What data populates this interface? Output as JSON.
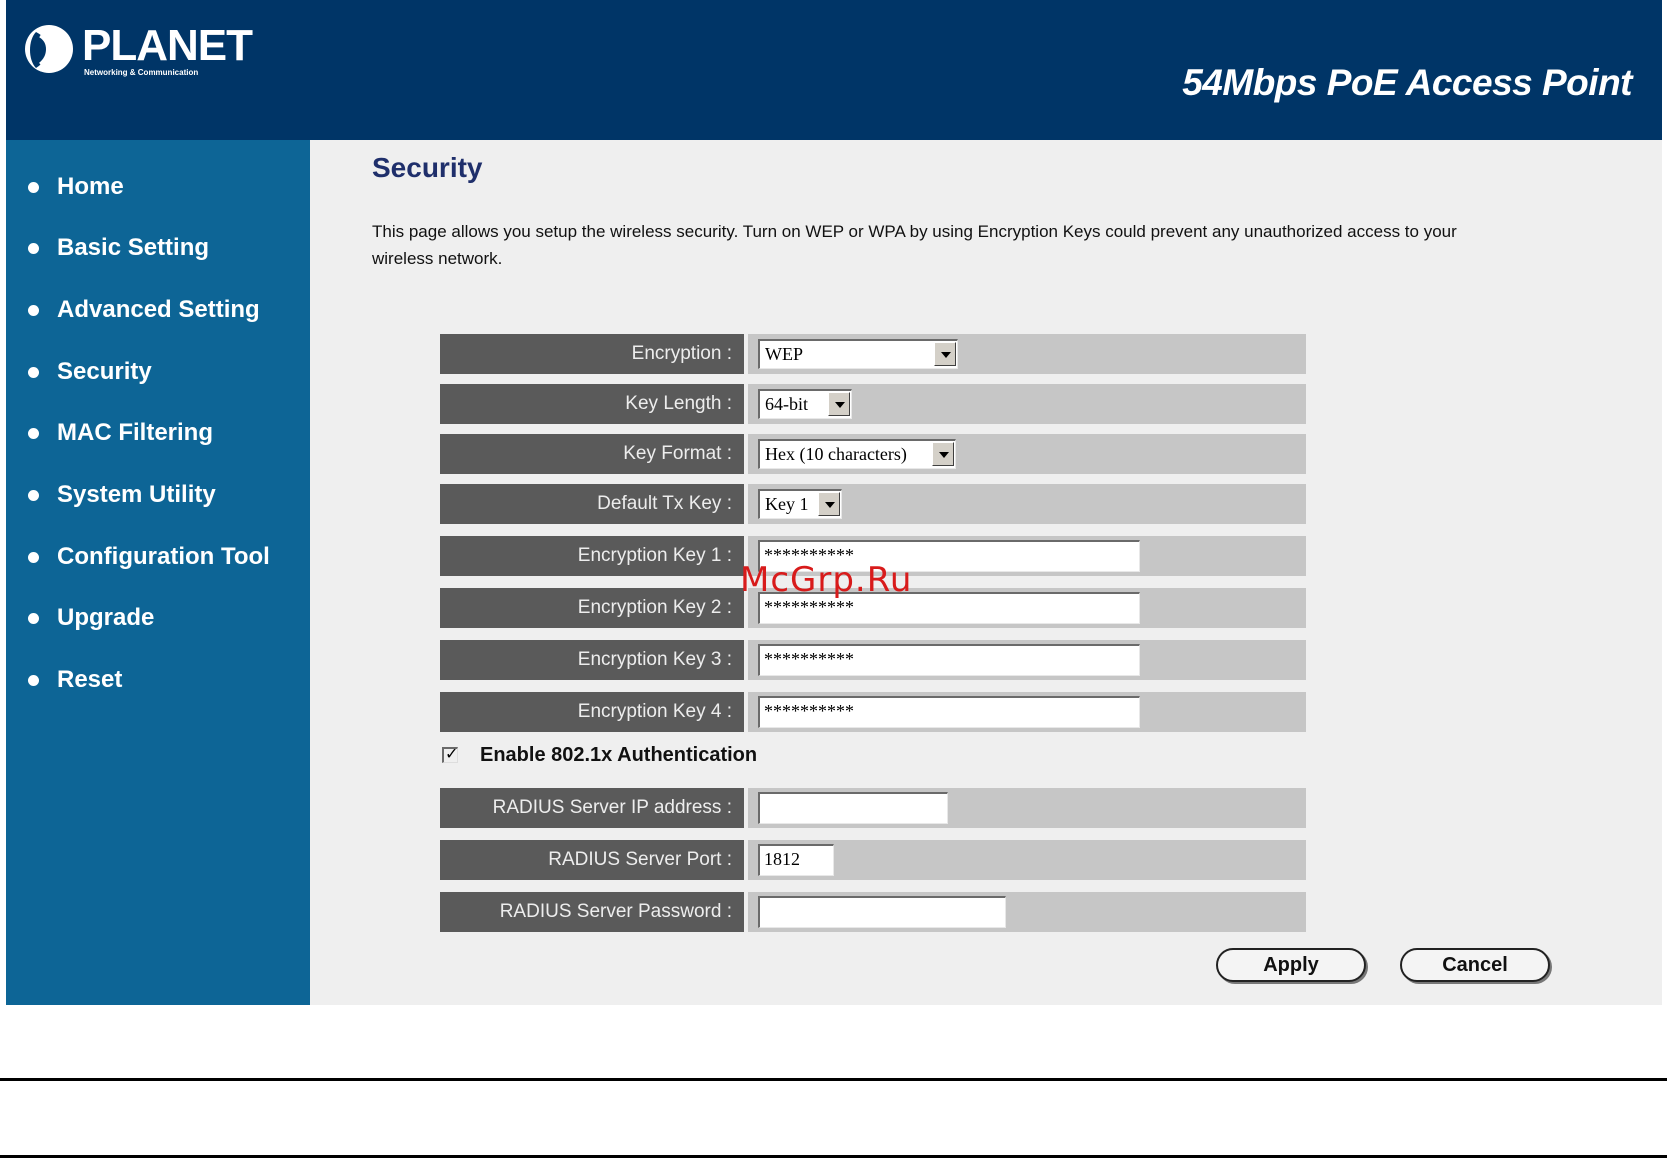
{
  "header": {
    "logo_text": "PLANET",
    "logo_tagline": "Networking & Communication",
    "product_title": "54Mbps PoE Access Point"
  },
  "sidebar": {
    "items": [
      {
        "label": "Home"
      },
      {
        "label": "Basic Setting"
      },
      {
        "label": "Advanced Setting"
      },
      {
        "label": "Security"
      },
      {
        "label": "MAC Filtering"
      },
      {
        "label": "System Utility"
      },
      {
        "label": "Configuration Tool"
      },
      {
        "label": "Upgrade"
      },
      {
        "label": "Reset"
      }
    ]
  },
  "main": {
    "title": "Security",
    "description": "This page allows you setup the wireless security. Turn on WEP or WPA by using Encryption Keys could prevent any unauthorized access to your wireless network.",
    "fields": {
      "encryption": {
        "label": "Encryption :",
        "value": "WEP"
      },
      "key_length": {
        "label": "Key Length :",
        "value": "64-bit"
      },
      "key_format": {
        "label": "Key Format :",
        "value": "Hex (10 characters)"
      },
      "default_tx_key": {
        "label": "Default Tx Key :",
        "value": "Key 1"
      },
      "encryption_key_1": {
        "label": "Encryption Key 1 :",
        "value": "**********"
      },
      "encryption_key_2": {
        "label": "Encryption Key 2 :",
        "value": "**********"
      },
      "encryption_key_3": {
        "label": "Encryption Key 3 :",
        "value": "**********"
      },
      "encryption_key_4": {
        "label": "Encryption Key 4 :",
        "value": "**********"
      },
      "radius_ip": {
        "label": "RADIUS Server IP address :",
        "value": ""
      },
      "radius_port": {
        "label": "RADIUS Server Port :",
        "value": "1812"
      },
      "radius_password": {
        "label": "RADIUS Server Password :",
        "value": ""
      }
    },
    "enable_8021x": {
      "label": "Enable 802.1x Authentication",
      "checked": true,
      "mark": "✓"
    },
    "buttons": {
      "apply": "Apply",
      "cancel": "Cancel"
    }
  },
  "watermark": "McGrp.Ru",
  "colors": {
    "header_bg": "#003567",
    "sidebar_bg": "#0d6596",
    "content_bg": "#efefef",
    "label_cell": "#5a5a5a",
    "field_cell": "#c6c6c6",
    "title_text": "#1f2f6b",
    "watermark": "#d81b1b"
  }
}
